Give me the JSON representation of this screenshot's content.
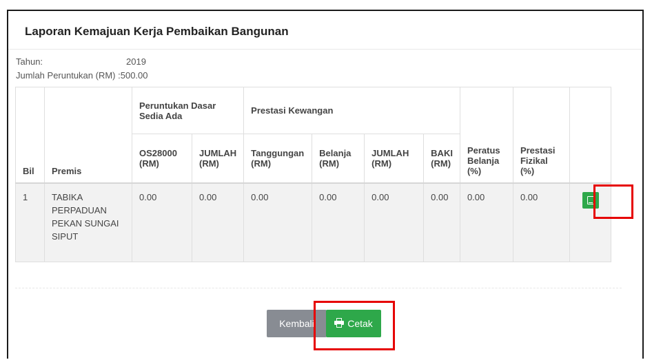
{
  "page": {
    "title": "Laporan Kemajuan Kerja Pembaikan Bangunan"
  },
  "info": {
    "year_label": "Tahun:",
    "year_value": "2019",
    "allocation_label": "Jumlah Peruntukan (RM) :",
    "allocation_value": "500.00"
  },
  "table": {
    "group_headers": {
      "peruntukan": "Peruntukan Dasar Sedia Ada",
      "prestasi": "Prestasi Kewangan"
    },
    "columns": {
      "bil": "Bil",
      "premis": "Premis",
      "os28000": "OS28000 (RM)",
      "jumlah1": "JUMLAH (RM)",
      "tanggungan": "Tanggungan (RM)",
      "belanja": "Belanja (RM)",
      "jumlah2": "JUMLAH (RM)",
      "baki": "BAKI (RM)",
      "peratus": "Peratus Belanja (%)",
      "fizikal": "Prestasi Fizikal (%)"
    },
    "rows": [
      {
        "bil": "1",
        "premis": "TABIKA PERPADUAN PEKAN SUNGAI SIPUT",
        "os28000": "0.00",
        "jumlah1": "0.00",
        "tanggungan": "0.00",
        "belanja": "0.00",
        "jumlah2": "0.00",
        "baki": "0.00",
        "peratus": "0.00",
        "fizikal": "0.00",
        "action_icon": "tablet-icon"
      }
    ]
  },
  "buttons": {
    "back_label": "Kembali",
    "print_label": "Cetak",
    "print_icon": "printer-icon"
  },
  "colors": {
    "success": "#2ea84a",
    "secondary": "#888c93",
    "highlight": "#e60000"
  }
}
